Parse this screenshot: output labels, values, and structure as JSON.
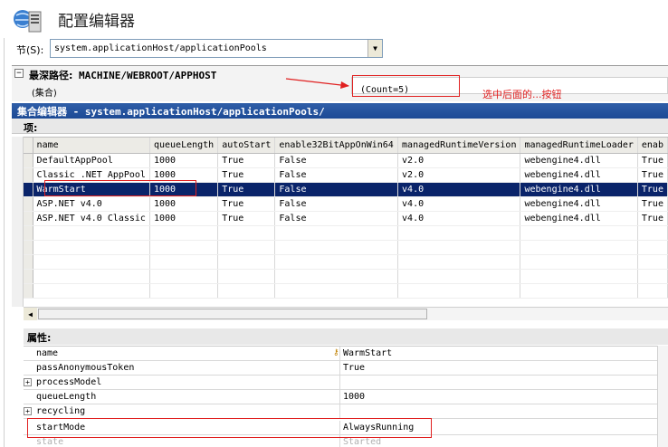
{
  "header": {
    "title": "配置编辑器",
    "icon": "iis-config-icon"
  },
  "section": {
    "label": "节(S):",
    "value": "system.applicationHost/applicationPools"
  },
  "path": {
    "label_prefix": "最深路径:",
    "label_value": "MACHINE/WEBROOT/APPHOST",
    "collection_label": "(集合)",
    "count_value": "(Count=5)",
    "annotation_text": "选中后面的...按钮"
  },
  "editor": {
    "title": "集合编辑器 - system.applicationHost/applicationPools/",
    "items_label": "项:",
    "columns": [
      "name",
      "queueLength",
      "autoStart",
      "enable32BitAppOnWin64",
      "managedRuntimeVersion",
      "managedRuntimeLoader",
      "enab"
    ],
    "rows": [
      [
        "DefaultAppPool",
        "1000",
        "True",
        "False",
        "v2.0",
        "webengine4.dll",
        "True"
      ],
      [
        "Classic .NET AppPool",
        "1000",
        "True",
        "False",
        "v2.0",
        "webengine4.dll",
        "True"
      ],
      [
        "WarmStart",
        "1000",
        "True",
        "False",
        "v4.0",
        "webengine4.dll",
        "True"
      ],
      [
        "ASP.NET v4.0",
        "1000",
        "True",
        "False",
        "v4.0",
        "webengine4.dll",
        "True"
      ],
      [
        "ASP.NET v4.0 Classic",
        "1000",
        "True",
        "False",
        "v4.0",
        "webengine4.dll",
        "True"
      ]
    ],
    "selected_row": 2
  },
  "properties": {
    "label": "属性:",
    "rows": [
      {
        "name": "name",
        "value": "WarmStart",
        "expandable": false
      },
      {
        "name": "passAnonymousToken",
        "value": "True",
        "expandable": false
      },
      {
        "name": "processModel",
        "value": "",
        "expandable": true
      },
      {
        "name": "queueLength",
        "value": "1000",
        "expandable": false
      },
      {
        "name": "recycling",
        "value": "",
        "expandable": true
      },
      {
        "name": "startMode",
        "value": "AlwaysRunning",
        "expandable": false
      },
      {
        "name": "state",
        "value": "Started",
        "expandable": false
      }
    ]
  },
  "colors": {
    "annotation": "#e02020",
    "selection": "#0a246a",
    "titlebar": "#2f5ea8"
  }
}
